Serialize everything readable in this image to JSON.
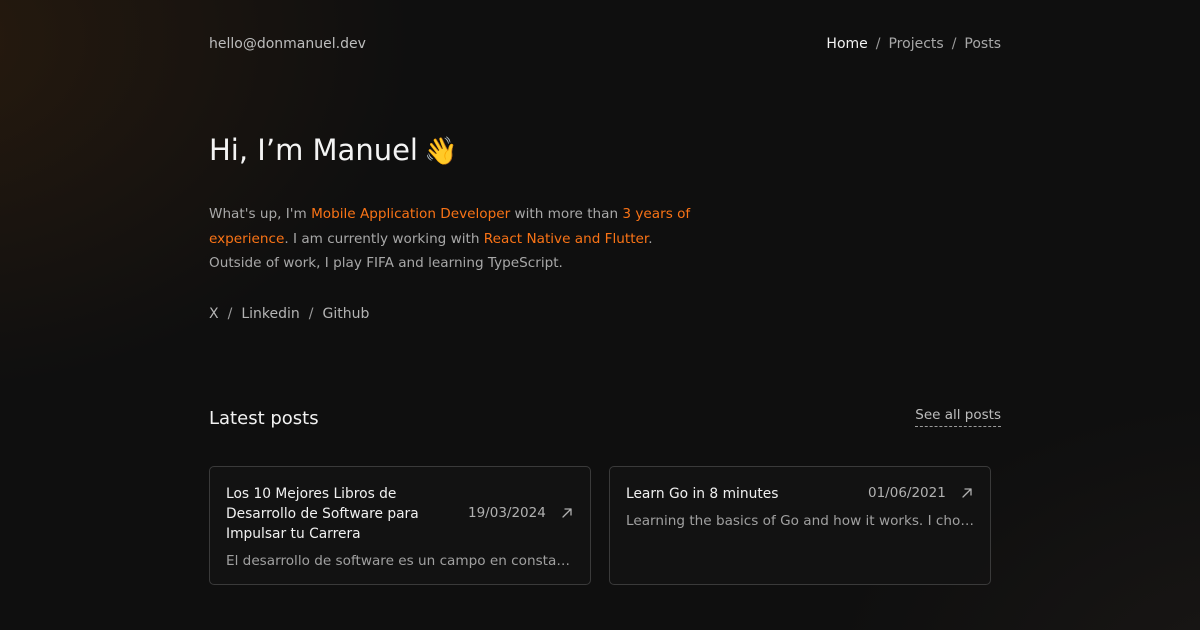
{
  "header": {
    "email": "hello@donmanuel.dev",
    "nav": [
      {
        "label": "Home",
        "active": true
      },
      {
        "label": "Projects",
        "active": false
      },
      {
        "label": "Posts",
        "active": false
      }
    ],
    "nav_separator": "/"
  },
  "hero": {
    "title": "Hi, I’m Manuel",
    "emoji": "👋",
    "intro": {
      "p1": "What's up, I'm ",
      "role": "Mobile Application Developer",
      "p2": " with more than ",
      "experience": "3 years of experience",
      "p3": ". I am currently working with ",
      "tech": "React Native and Flutter",
      "p4": ". Outside of work, I play FIFA and learning TypeScript."
    },
    "highlight_color": "#f97316"
  },
  "socials": {
    "items": [
      "X",
      "Linkedin",
      "Github"
    ],
    "separator": "/"
  },
  "posts": {
    "heading": "Latest posts",
    "see_all": "See all posts",
    "items": [
      {
        "title": "Los 10 Mejores Libros de Desarrollo de Software para Impulsar tu Carrera",
        "date": "19/03/2024",
        "excerpt": "El desarrollo de software es un campo en constante…",
        "icon": "arrow-up-right-icon"
      },
      {
        "title": "Learn Go in 8 minutes",
        "date": "01/06/2021",
        "excerpt": "Learning the basics of Go and how it works. I chose …",
        "icon": "arrow-up-right-icon"
      }
    ]
  }
}
